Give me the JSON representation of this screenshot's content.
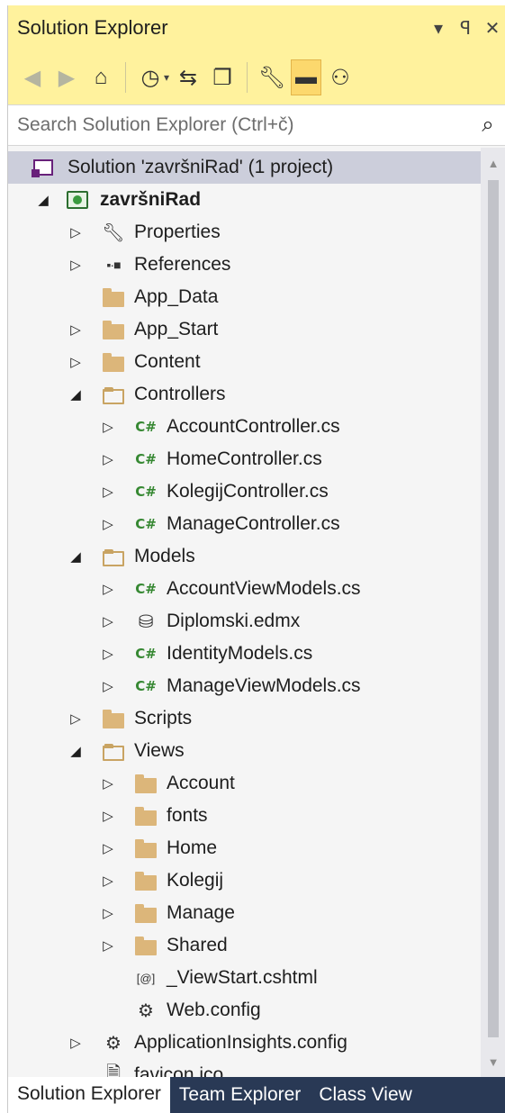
{
  "window": {
    "title": "Solution Explorer",
    "buttons": {
      "dropdown": "▾",
      "pin": "ꟼ",
      "close": "✕"
    }
  },
  "toolbar": {
    "icons": [
      "back-icon",
      "forward-icon",
      "home-icon",
      "history-icon",
      "sync-icon",
      "collapse-all-icon",
      "properties-wrench-icon",
      "show-all-files-icon",
      "preview-icon"
    ]
  },
  "search": {
    "placeholder": "Search Solution Explorer (Ctrl+č)",
    "value": ""
  },
  "tree": {
    "solution": "Solution 'završniRad' (1 project)",
    "project": "završniRad",
    "properties": "Properties",
    "references": "References",
    "app_data": "App_Data",
    "app_start": "App_Start",
    "content": "Content",
    "controllers": "Controllers",
    "controller_files": [
      "AccountController.cs",
      "HomeController.cs",
      "KolegijController.cs",
      "ManageController.cs"
    ],
    "models": "Models",
    "model_files": [
      "AccountViewModels.cs",
      "Diplomski.edmx",
      "IdentityModels.cs",
      "ManageViewModels.cs"
    ],
    "scripts": "Scripts",
    "views": "Views",
    "view_folders": [
      "Account",
      "fonts",
      "Home",
      "Kolegij",
      "Manage",
      "Shared"
    ],
    "viewstart": "_ViewStart.cshtml",
    "views_webconfig": "Web.config",
    "appinsights": "ApplicationInsights.config",
    "favicon": "favicon.ico"
  },
  "tabs": [
    "Solution Explorer",
    "Team Explorer",
    "Class View"
  ],
  "colors": {
    "titlebar": "#fff29d",
    "selection": "#cccedb",
    "tab_strip": "#293955",
    "csharp": "#368832"
  }
}
